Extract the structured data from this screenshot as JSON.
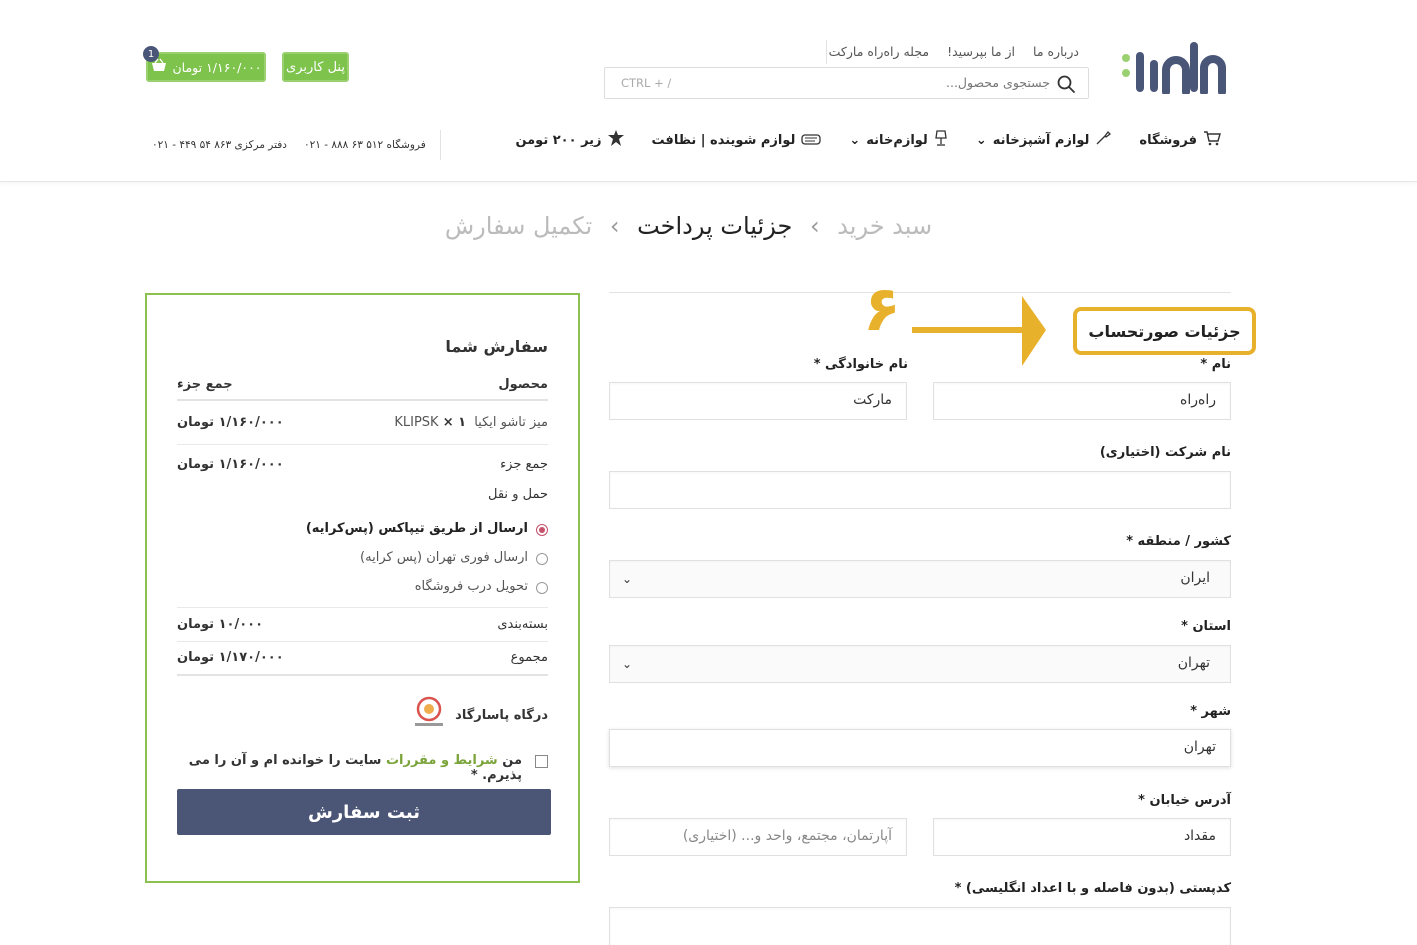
{
  "header": {
    "logo_alt": "راه‌راه مارکت",
    "top_links": [
      "درباره ما",
      "از ما بپرسید!",
      "مجله راه‌راه مارکت"
    ],
    "search_placeholder": "جستجوی محصول...",
    "search_shortcut": "CTRL + /",
    "user_panel_label": "پنل کاربری",
    "cart_label": "۱/۱۶۰/۰۰۰ تومان",
    "cart_count": "1",
    "nav": [
      {
        "label": "فروشگاه",
        "icon": "cart-icon"
      },
      {
        "label": "لوازم آشپزخانه",
        "icon": "spatula-icon",
        "dropdown": true
      },
      {
        "label": "لوازم‌خانه",
        "icon": "lamp-icon",
        "dropdown": true
      },
      {
        "label": "لوازم شوینده | نظافت",
        "icon": "soap-icon"
      },
      {
        "label": "زیر ۲۰۰ تومن",
        "icon": "star-badge-icon"
      }
    ],
    "phone_shop": "فروشگاه ۵۱۲ ۶۳ ۸۸۸ - ۰۲۱",
    "phone_office": "دفتر مرکزی ۸۶۳ ۵۴ ۴۴۹ - ۰۲۱"
  },
  "breadcrumb": {
    "step1": "سبد خرید",
    "step2": "جزئیات پرداخت",
    "step3": "تکمیل سفارش",
    "separator": "›"
  },
  "billing": {
    "heading": "جزئیات صورتحساب",
    "step_number": "۶",
    "first_name_label": "نام *",
    "first_name_value": "راه‌راه",
    "last_name_label": "نام خانوادگی *",
    "last_name_value": "مارکت",
    "company_label": "نام شرکت (اختیاری)",
    "company_value": "",
    "country_label": "کشور / منطقه *",
    "country_value": "ایران",
    "state_label": "استان *",
    "state_value": "تهران",
    "city_label": "شهر *",
    "city_value": "تهران",
    "address_label": "آدرس خیابان *",
    "address1_value": "مقداد",
    "address2_placeholder": "آپارتمان، مجتمع، واحد و... (اختیاری)",
    "postcode_label": "کدپستی (بدون فاصله و با اعداد انگلیسی) *"
  },
  "order": {
    "title": "سفارش شما",
    "col_product": "محصول",
    "col_subtotal": "جمع جزء",
    "item_name": "میز تاشو ایکیا KLIPSK",
    "item_qty": "× ۱",
    "item_price": "۱/۱۶۰/۰۰۰ تومان",
    "subtotal_label": "جمع جزء",
    "subtotal_value": "۱/۱۶۰/۰۰۰ تومان",
    "shipping_label": "حمل و نقل",
    "shipping_options": [
      {
        "label": "ارسال از طریق تیپاکس (پس‌کرایه)",
        "selected": true
      },
      {
        "label": "ارسال فوری تهران (پس کرایه)",
        "selected": false
      },
      {
        "label": "تحویل درب فروشگاه",
        "selected": false
      }
    ],
    "packaging_label": "بسته‌بندی",
    "packaging_value": "۱۰/۰۰۰ تومان",
    "total_label": "مجموع",
    "total_value": "۱/۱۷۰/۰۰۰ تومان",
    "gateway_label": "درگاه پاسارگاد",
    "terms_prefix": "من",
    "terms_link": "شرایط و مقررات",
    "terms_suffix": "سایت را خوانده ام و آن را می پذیرم.",
    "terms_required": "*",
    "submit_label": "ثبت سفارش"
  },
  "colors": {
    "brand_blue": "#4a5678",
    "brand_green": "#7dc34c",
    "highlight_yellow": "#e8b12c",
    "submit_bg": "#4b5576"
  }
}
